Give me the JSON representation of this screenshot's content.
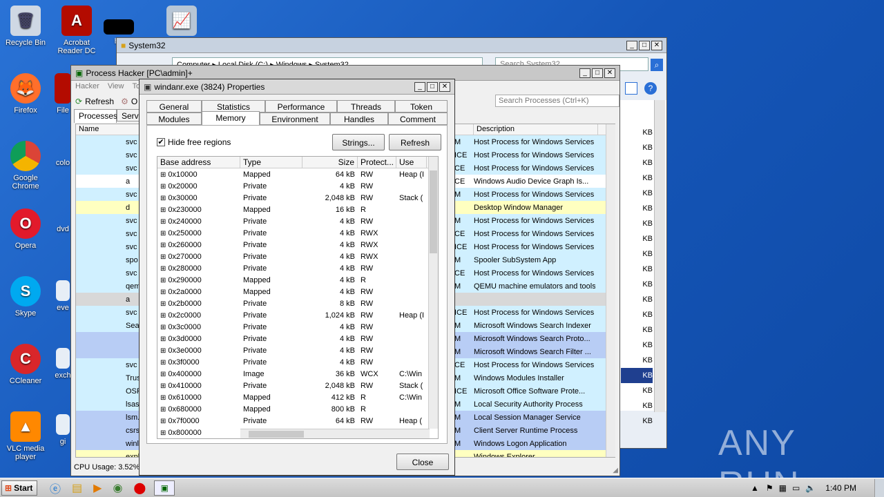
{
  "desktop_icons": [
    {
      "label": "Recycle Bin",
      "icon": "recycle-bin-icon"
    },
    {
      "label": "Acrobat Reader DC",
      "icon": "acrobat-icon"
    },
    {
      "label": "Firefox",
      "icon": "firefox-icon"
    },
    {
      "label": "File",
      "icon": "file-icon"
    },
    {
      "label": "Google Chrome",
      "icon": "chrome-icon"
    },
    {
      "label": "colo",
      "icon": "file-icon"
    },
    {
      "label": "Opera",
      "icon": "opera-icon"
    },
    {
      "label": "dvd",
      "icon": "file-icon"
    },
    {
      "label": "Skype",
      "icon": "skype-icon"
    },
    {
      "label": "eve",
      "icon": "file-icon"
    },
    {
      "label": "CCleaner",
      "icon": "ccleaner-icon"
    },
    {
      "label": "exch",
      "icon": "file-icon"
    },
    {
      "label": "VLC media player",
      "icon": "vlc-icon"
    },
    {
      "label": "gi",
      "icon": "file-icon"
    },
    {
      "label": "hi",
      "icon": "file-icon"
    }
  ],
  "explorer": {
    "title": "System32",
    "breadcrumb": "Computer   ▸  Local Disk (C:)   ▸  Windows   ▸  System32",
    "search_placeholder": "Search System32"
  },
  "process_hacker": {
    "title": "Process Hacker [PC\\admin]+",
    "menu": [
      "Hacker",
      "View",
      "To"
    ],
    "toolbar_refresh": "Refresh",
    "toolbar_options": "O",
    "tabs": [
      "Processes",
      "Servic"
    ],
    "search_placeholder": "Search Processes (Ctrl+K)",
    "col_name": "Name",
    "col_description": "Description",
    "status": "CPU Usage: 3.52%",
    "rows": [
      {
        "name": "svc",
        "flag": "M",
        "description": "Host Process for Windows Services",
        "mem": "KB",
        "color": "#d0f0ff"
      },
      {
        "name": "svc",
        "flag": "ICE",
        "description": "Host Process for Windows Services",
        "mem": "KB",
        "color": "#d0f0ff"
      },
      {
        "name": "svc",
        "flag": "CE",
        "description": "Host Process for Windows Services",
        "mem": "KB",
        "color": "#d0f0ff"
      },
      {
        "name": "a",
        "flag": "CE",
        "description": "Windows Audio Device Graph Is...",
        "mem": "KB",
        "color": "#ffffff"
      },
      {
        "name": "svc",
        "flag": "M",
        "description": "Host Process for Windows Services",
        "mem": "KB",
        "color": "#d0f0ff"
      },
      {
        "name": "d",
        "flag": "",
        "description": "Desktop Window Manager",
        "mem": "KB",
        "color": "#ffffc0"
      },
      {
        "name": "svc",
        "flag": "M",
        "description": "Host Process for Windows Services",
        "mem": "KB",
        "color": "#d0f0ff"
      },
      {
        "name": "svc",
        "flag": "CE",
        "description": "Host Process for Windows Services",
        "mem": "KB",
        "color": "#d0f0ff"
      },
      {
        "name": "svc",
        "flag": "ICE",
        "description": "Host Process for Windows Services",
        "mem": "KB",
        "color": "#d0f0ff"
      },
      {
        "name": "spo",
        "flag": "M",
        "description": "Spooler SubSystem App",
        "mem": "KB",
        "color": "#d0f0ff"
      },
      {
        "name": "svc",
        "flag": "CE",
        "description": "Host Process for Windows Services",
        "mem": "KB",
        "color": "#d0f0ff"
      },
      {
        "name": "qem",
        "flag": "M",
        "description": "QEMU machine emulators and tools",
        "mem": "KB",
        "color": "#d0f0ff"
      },
      {
        "name": "a",
        "flag": "",
        "description": "",
        "mem": "KB",
        "color": "#d8d8d8"
      },
      {
        "name": "svc",
        "flag": "ICE",
        "description": "Host Process for Windows Services",
        "mem": "KB",
        "color": "#d0f0ff"
      },
      {
        "name": "Sea",
        "flag": "M",
        "description": "Microsoft Windows Search Indexer",
        "mem": "KB",
        "color": "#d0f0ff"
      },
      {
        "name": "",
        "flag": "M",
        "description": "Microsoft Windows Search Proto...",
        "mem": "KB",
        "color": "#b8cdf5"
      },
      {
        "name": "",
        "flag": "M",
        "description": "Microsoft Windows Search Filter ...",
        "mem": "KB",
        "color": "#b8cdf5"
      },
      {
        "name": "svc",
        "flag": "CE",
        "description": "Host Process for Windows Services",
        "mem": "KB",
        "color": "#d0f0ff"
      },
      {
        "name": "Trus",
        "flag": "M",
        "description": "Windows Modules Installer",
        "mem": "KB",
        "color": "#d0f0ff"
      },
      {
        "name": "OSF",
        "flag": "ICE",
        "description": "Microsoft Office Software Prote...",
        "mem": "KB",
        "color": "#d0f0ff"
      },
      {
        "name": "lsass.e",
        "flag": "M",
        "description": "Local Security Authority Process",
        "mem": "KB",
        "color": "#d0f0ff"
      },
      {
        "name": "lsm.exe",
        "flag": "M",
        "description": "Local Session Manager Service",
        "mem": "KB",
        "color": "#b8cdf5"
      },
      {
        "name": "csrss.exe",
        "flag": "M",
        "description": "Client Server Runtime Process",
        "mem": "KB",
        "color": "#b8cdf5"
      },
      {
        "name": "winlogon.e",
        "flag": "M",
        "description": "Windows Logon Application",
        "mem": "KB",
        "color": "#b8cdf5"
      },
      {
        "name": "explorer.e",
        "flag": "",
        "description": "Windows Explorer",
        "mem": "KB",
        "color": "#ffffc0"
      }
    ]
  },
  "properties": {
    "title": "windanr.exe (3824) Properties",
    "tabs_row1": [
      "General",
      "Statistics",
      "Performance",
      "Threads",
      "Token"
    ],
    "tabs_row2": [
      "Modules",
      "Memory",
      "Environment",
      "Handles",
      "Comment"
    ],
    "selected_tab": "Memory",
    "hide_free_label": "Hide free regions",
    "hide_free_checked": true,
    "strings_button": "Strings...",
    "refresh_button": "Refresh",
    "close_button": "Close",
    "columns": [
      "Base address",
      "Type",
      "Size",
      "Protect...",
      "Use"
    ],
    "rows": [
      {
        "addr": "0x10000",
        "type": "Mapped",
        "size": "64 kB",
        "prot": "RW",
        "use": "Heap (I"
      },
      {
        "addr": "0x20000",
        "type": "Private",
        "size": "4 kB",
        "prot": "RW",
        "use": ""
      },
      {
        "addr": "0x30000",
        "type": "Private",
        "size": "2,048 kB",
        "prot": "RW",
        "use": "Stack ("
      },
      {
        "addr": "0x230000",
        "type": "Mapped",
        "size": "16 kB",
        "prot": "R",
        "use": ""
      },
      {
        "addr": "0x240000",
        "type": "Private",
        "size": "4 kB",
        "prot": "RW",
        "use": ""
      },
      {
        "addr": "0x250000",
        "type": "Private",
        "size": "4 kB",
        "prot": "RWX",
        "use": ""
      },
      {
        "addr": "0x260000",
        "type": "Private",
        "size": "4 kB",
        "prot": "RWX",
        "use": ""
      },
      {
        "addr": "0x270000",
        "type": "Private",
        "size": "4 kB",
        "prot": "RWX",
        "use": ""
      },
      {
        "addr": "0x280000",
        "type": "Private",
        "size": "4 kB",
        "prot": "RW",
        "use": ""
      },
      {
        "addr": "0x290000",
        "type": "Mapped",
        "size": "4 kB",
        "prot": "R",
        "use": ""
      },
      {
        "addr": "0x2a0000",
        "type": "Mapped",
        "size": "4 kB",
        "prot": "RW",
        "use": ""
      },
      {
        "addr": "0x2b0000",
        "type": "Private",
        "size": "8 kB",
        "prot": "RW",
        "use": ""
      },
      {
        "addr": "0x2c0000",
        "type": "Private",
        "size": "1,024 kB",
        "prot": "RW",
        "use": "Heap (I"
      },
      {
        "addr": "0x3c0000",
        "type": "Private",
        "size": "4 kB",
        "prot": "RW",
        "use": ""
      },
      {
        "addr": "0x3d0000",
        "type": "Private",
        "size": "4 kB",
        "prot": "RW",
        "use": ""
      },
      {
        "addr": "0x3e0000",
        "type": "Private",
        "size": "4 kB",
        "prot": "RW",
        "use": ""
      },
      {
        "addr": "0x3f0000",
        "type": "Private",
        "size": "4 kB",
        "prot": "RW",
        "use": ""
      },
      {
        "addr": "0x400000",
        "type": "Image",
        "size": "36 kB",
        "prot": "WCX",
        "use": "C:\\Win"
      },
      {
        "addr": "0x410000",
        "type": "Private",
        "size": "2,048 kB",
        "prot": "RW",
        "use": "Stack ("
      },
      {
        "addr": "0x610000",
        "type": "Mapped",
        "size": "412 kB",
        "prot": "R",
        "use": "C:\\Win"
      },
      {
        "addr": "0x680000",
        "type": "Mapped",
        "size": "800 kB",
        "prot": "R",
        "use": ""
      },
      {
        "addr": "0x7f0000",
        "type": "Private",
        "size": "64 kB",
        "prot": "RW",
        "use": "Heap ("
      },
      {
        "addr": "0x800000",
        "type": "",
        "size": "",
        "prot": "",
        "use": ""
      }
    ]
  },
  "taskbar": {
    "start_label": "Start",
    "clock": "1:40 PM"
  },
  "watermark": "ANY RUN"
}
